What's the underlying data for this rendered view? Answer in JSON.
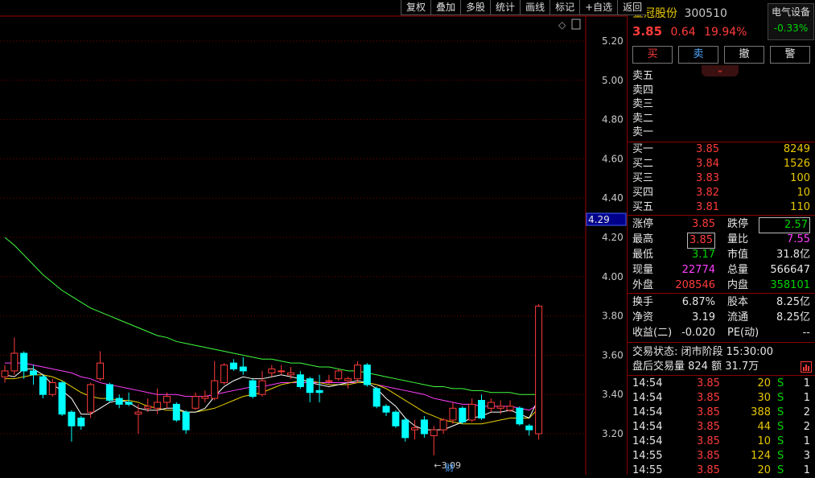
{
  "toolbar": [
    "复权",
    "叠加",
    "多股",
    "统计",
    "画线",
    "标记",
    "+自选",
    "返回"
  ],
  "chart": {
    "corner_icons": [
      "◇",
      "▯"
    ],
    "y_ticks": [
      "5.20",
      "5.00",
      "4.80",
      "4.60",
      "4.40",
      "4.20",
      "4.00",
      "3.80",
      "3.60",
      "3.40",
      "3.20"
    ],
    "current_price_tag": "4.29",
    "low_marker": "←3.09",
    "fin_marker": "财"
  },
  "chart_data": {
    "type": "candlestick",
    "ylim": [
      3.1,
      5.3
    ],
    "candles": [
      {
        "o": 3.49,
        "c": 3.52,
        "h": 3.55,
        "l": 3.46
      },
      {
        "o": 3.52,
        "c": 3.61,
        "h": 3.69,
        "l": 3.5
      },
      {
        "o": 3.61,
        "c": 3.52,
        "h": 3.62,
        "l": 3.48
      },
      {
        "o": 3.52,
        "c": 3.5,
        "h": 3.55,
        "l": 3.45
      },
      {
        "o": 3.49,
        "c": 3.4,
        "h": 3.5,
        "l": 3.38
      },
      {
        "o": 3.4,
        "c": 3.46,
        "h": 3.48,
        "l": 3.39
      },
      {
        "o": 3.46,
        "c": 3.3,
        "h": 3.47,
        "l": 3.29
      },
      {
        "o": 3.31,
        "c": 3.24,
        "h": 3.32,
        "l": 3.16
      },
      {
        "o": 3.28,
        "c": 3.24,
        "h": 3.29,
        "l": 3.22
      },
      {
        "o": 3.31,
        "c": 3.45,
        "h": 3.46,
        "l": 3.28
      },
      {
        "o": 3.48,
        "c": 3.56,
        "h": 3.62,
        "l": 3.47
      },
      {
        "o": 3.45,
        "c": 3.37,
        "h": 3.46,
        "l": 3.36
      },
      {
        "o": 3.38,
        "c": 3.35,
        "h": 3.4,
        "l": 3.33
      },
      {
        "o": 3.36,
        "c": 3.35,
        "h": 3.41,
        "l": 3.34
      },
      {
        "o": 3.3,
        "c": 3.31,
        "h": 3.35,
        "l": 3.2
      },
      {
        "o": 3.33,
        "c": 3.34,
        "h": 3.38,
        "l": 3.31
      },
      {
        "o": 3.33,
        "c": 3.36,
        "h": 3.43,
        "l": 3.3
      },
      {
        "o": 3.36,
        "c": 3.39,
        "h": 3.41,
        "l": 3.33
      },
      {
        "o": 3.35,
        "c": 3.27,
        "h": 3.36,
        "l": 3.26
      },
      {
        "o": 3.31,
        "c": 3.22,
        "h": 3.32,
        "l": 3.2
      },
      {
        "o": 3.33,
        "c": 3.39,
        "h": 3.41,
        "l": 3.32
      },
      {
        "o": 3.38,
        "c": 3.39,
        "h": 3.42,
        "l": 3.36
      },
      {
        "o": 3.38,
        "c": 3.47,
        "h": 3.57,
        "l": 3.37
      },
      {
        "o": 3.46,
        "c": 3.55,
        "h": 3.56,
        "l": 3.45
      },
      {
        "o": 3.56,
        "c": 3.53,
        "h": 3.58,
        "l": 3.52
      },
      {
        "o": 3.54,
        "c": 3.52,
        "h": 3.59,
        "l": 3.5
      },
      {
        "o": 3.47,
        "c": 3.39,
        "h": 3.48,
        "l": 3.38
      },
      {
        "o": 3.4,
        "c": 3.47,
        "h": 3.52,
        "l": 3.39
      },
      {
        "o": 3.51,
        "c": 3.53,
        "h": 3.55,
        "l": 3.49
      },
      {
        "o": 3.52,
        "c": 3.52,
        "h": 3.55,
        "l": 3.5
      },
      {
        "o": 3.5,
        "c": 3.51,
        "h": 3.54,
        "l": 3.48
      },
      {
        "o": 3.5,
        "c": 3.44,
        "h": 3.52,
        "l": 3.43
      },
      {
        "o": 3.48,
        "c": 3.41,
        "h": 3.49,
        "l": 3.36
      },
      {
        "o": 3.42,
        "c": 3.41,
        "h": 3.5,
        "l": 3.36
      },
      {
        "o": 3.47,
        "c": 3.47,
        "h": 3.5,
        "l": 3.45
      },
      {
        "o": 3.48,
        "c": 3.52,
        "h": 3.53,
        "l": 3.47
      },
      {
        "o": 3.47,
        "c": 3.48,
        "h": 3.49,
        "l": 3.43
      },
      {
        "o": 3.48,
        "c": 3.55,
        "h": 3.57,
        "l": 3.46
      },
      {
        "o": 3.55,
        "c": 3.45,
        "h": 3.56,
        "l": 3.44
      },
      {
        "o": 3.43,
        "c": 3.34,
        "h": 3.44,
        "l": 3.33
      },
      {
        "o": 3.34,
        "c": 3.31,
        "h": 3.35,
        "l": 3.29
      },
      {
        "o": 3.31,
        "c": 3.24,
        "h": 3.32,
        "l": 3.23
      },
      {
        "o": 3.27,
        "c": 3.18,
        "h": 3.28,
        "l": 3.16
      },
      {
        "o": 3.22,
        "c": 3.23,
        "h": 3.27,
        "l": 3.17
      },
      {
        "o": 3.27,
        "c": 3.2,
        "h": 3.29,
        "l": 3.18
      },
      {
        "o": 3.19,
        "c": 3.22,
        "h": 3.24,
        "l": 3.09
      },
      {
        "o": 3.22,
        "c": 3.27,
        "h": 3.28,
        "l": 3.2
      },
      {
        "o": 3.27,
        "c": 3.33,
        "h": 3.36,
        "l": 3.25
      },
      {
        "o": 3.33,
        "c": 3.26,
        "h": 3.34,
        "l": 3.25
      },
      {
        "o": 3.27,
        "c": 3.35,
        "h": 3.38,
        "l": 3.26
      },
      {
        "o": 3.37,
        "c": 3.28,
        "h": 3.4,
        "l": 3.27
      },
      {
        "o": 3.33,
        "c": 3.36,
        "h": 3.38,
        "l": 3.31
      },
      {
        "o": 3.33,
        "c": 3.34,
        "h": 3.37,
        "l": 3.3
      },
      {
        "o": 3.32,
        "c": 3.34,
        "h": 3.37,
        "l": 3.31
      },
      {
        "o": 3.33,
        "c": 3.25,
        "h": 3.34,
        "l": 3.24
      },
      {
        "o": 3.24,
        "c": 3.22,
        "h": 3.25,
        "l": 3.19
      },
      {
        "o": 3.2,
        "c": 3.85,
        "h": 3.86,
        "l": 3.17
      }
    ],
    "ma_white": [
      3.5,
      3.49,
      3.53,
      3.53,
      3.5,
      3.45,
      3.42,
      3.38,
      3.3,
      3.3,
      3.33,
      3.36,
      3.37,
      3.36,
      3.33,
      3.32,
      3.32,
      3.33,
      3.33,
      3.31,
      3.31,
      3.33,
      3.39,
      3.44,
      3.47,
      3.49,
      3.48,
      3.48,
      3.49,
      3.5,
      3.49,
      3.48,
      3.46,
      3.45,
      3.44,
      3.45,
      3.46,
      3.47,
      3.46,
      3.43,
      3.38,
      3.34,
      3.28,
      3.24,
      3.22,
      3.22,
      3.22,
      3.24,
      3.26,
      3.28,
      3.29,
      3.31,
      3.31,
      3.32,
      3.3,
      3.28,
      3.38
    ],
    "ma_yellow": [
      3.48,
      3.48,
      3.49,
      3.5,
      3.5,
      3.49,
      3.47,
      3.44,
      3.41,
      3.39,
      3.38,
      3.38,
      3.37,
      3.37,
      3.36,
      3.34,
      3.33,
      3.32,
      3.32,
      3.31,
      3.31,
      3.32,
      3.33,
      3.35,
      3.37,
      3.39,
      3.4,
      3.41,
      3.43,
      3.45,
      3.46,
      3.47,
      3.47,
      3.46,
      3.45,
      3.45,
      3.45,
      3.46,
      3.46,
      3.45,
      3.43,
      3.4,
      3.37,
      3.34,
      3.31,
      3.29,
      3.27,
      3.26,
      3.25,
      3.25,
      3.25,
      3.26,
      3.27,
      3.28,
      3.28,
      3.28,
      3.33
    ],
    "ma_magenta": [
      3.56,
      3.56,
      3.56,
      3.55,
      3.54,
      3.53,
      3.52,
      3.51,
      3.49,
      3.48,
      3.46,
      3.45,
      3.44,
      3.43,
      3.42,
      3.41,
      3.4,
      3.4,
      3.4,
      3.39,
      3.39,
      3.39,
      3.4,
      3.41,
      3.42,
      3.43,
      3.44,
      3.44,
      3.45,
      3.46,
      3.46,
      3.46,
      3.46,
      3.46,
      3.46,
      3.46,
      3.46,
      3.46,
      3.46,
      3.45,
      3.44,
      3.43,
      3.42,
      3.41,
      3.4,
      3.38,
      3.37,
      3.36,
      3.35,
      3.35,
      3.34,
      3.34,
      3.34,
      3.34,
      3.33,
      3.32,
      3.35
    ],
    "ma_green": [
      4.2,
      4.16,
      4.11,
      4.06,
      4.01,
      3.97,
      3.93,
      3.9,
      3.87,
      3.84,
      3.82,
      3.8,
      3.78,
      3.76,
      3.74,
      3.72,
      3.7,
      3.69,
      3.67,
      3.66,
      3.65,
      3.64,
      3.63,
      3.62,
      3.61,
      3.6,
      3.59,
      3.58,
      3.58,
      3.57,
      3.56,
      3.56,
      3.55,
      3.54,
      3.54,
      3.53,
      3.52,
      3.52,
      3.51,
      3.5,
      3.49,
      3.48,
      3.47,
      3.46,
      3.45,
      3.44,
      3.44,
      3.43,
      3.43,
      3.42,
      3.42,
      3.41,
      3.41,
      3.41,
      3.4,
      3.4,
      3.4
    ]
  },
  "colors": {
    "up": "#ff3b3b",
    "down": "#00ffff",
    "ma_white": "#ffffff",
    "ma_yellow": "#e8d000",
    "ma_magenta": "#ff40ff",
    "ma_green": "#40ff40",
    "grid": "#7a0000"
  },
  "stock": {
    "name": "金冠股份",
    "code": "300510",
    "sector": "电气设备",
    "sector_change": "-0.33%",
    "price": "3.85",
    "change": "0.64",
    "pct": "19.94%"
  },
  "actions": [
    "买",
    "卖",
    "撤",
    "警"
  ],
  "collapse_icon": "⌄",
  "asks": [
    "卖五",
    "卖四",
    "卖三",
    "卖二",
    "卖一"
  ],
  "bids": [
    {
      "label": "买一",
      "price": "3.85",
      "vol": "8249"
    },
    {
      "label": "买二",
      "price": "3.84",
      "vol": "1526"
    },
    {
      "label": "买三",
      "price": "3.83",
      "vol": "100"
    },
    {
      "label": "买四",
      "price": "3.82",
      "vol": "10"
    },
    {
      "label": "买五",
      "price": "3.81",
      "vol": "110"
    }
  ],
  "stats1": [
    {
      "l1": "涨停",
      "v1": "3.85",
      "l2": "跌停",
      "v2": "2.57"
    },
    {
      "l1": "最高",
      "v1": "3.85",
      "l2": "量比",
      "v2": "7.55"
    },
    {
      "l1": "最低",
      "v1": "3.17",
      "l2": "市值",
      "v2": "31.8亿"
    },
    {
      "l1": "现量",
      "v1": "22774",
      "l2": "总量",
      "v2": "566647"
    },
    {
      "l1": "外盘",
      "v1": "208546",
      "l2": "内盘",
      "v2": "358101"
    }
  ],
  "stats2": [
    {
      "l1": "换手",
      "v1": "6.87%",
      "l2": "股本",
      "v2": "8.25亿"
    },
    {
      "l1": "净资",
      "v1": "3.19",
      "l2": "流通",
      "v2": "8.25亿"
    },
    {
      "l1": "收益(二)",
      "v1": "-0.020",
      "l2": "PE(动)",
      "v2": "--"
    }
  ],
  "status": {
    "label": "交易状态:",
    "value": "闭市阶段 15:30:00"
  },
  "after_hours": {
    "text": "盘后交易量 824 额 31.7万"
  },
  "ticks": [
    {
      "time": "14:54",
      "price": "3.85",
      "vol": "20",
      "side": "S",
      "n": "1"
    },
    {
      "time": "14:54",
      "price": "3.85",
      "vol": "30",
      "side": "S",
      "n": "1"
    },
    {
      "time": "14:54",
      "price": "3.85",
      "vol": "388",
      "side": "S",
      "n": "2"
    },
    {
      "time": "14:54",
      "price": "3.85",
      "vol": "44",
      "side": "S",
      "n": "2"
    },
    {
      "time": "14:54",
      "price": "3.85",
      "vol": "10",
      "side": "S",
      "n": "1"
    },
    {
      "time": "14:55",
      "price": "3.85",
      "vol": "124",
      "side": "S",
      "n": "3"
    },
    {
      "time": "14:55",
      "price": "3.85",
      "vol": "20",
      "side": "S",
      "n": "1"
    }
  ]
}
